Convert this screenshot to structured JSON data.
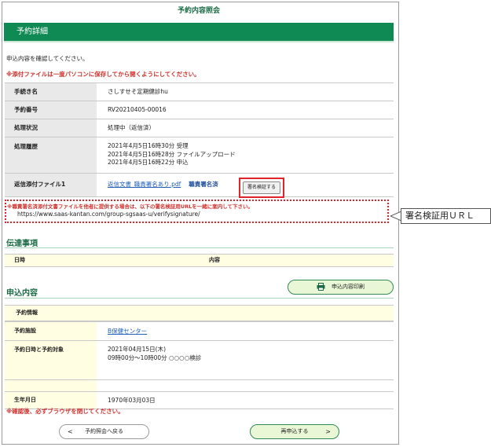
{
  "header": {
    "title": "予約内容照会"
  },
  "band": {
    "label": "予約詳細"
  },
  "messages": {
    "confirm": "申込内容を確認してください。",
    "warning": "※添付ファイルは一度パソコンに保存してから開くようにしてください。"
  },
  "details": [
    {
      "key": "手続き名",
      "value": "さしすせそ定期健診hu"
    },
    {
      "key": "予約番号",
      "value": "RV20210405-00016"
    },
    {
      "key": "処理状況",
      "value": "処理中（返信済）"
    },
    {
      "key": "処理履歴",
      "lines": [
        "2021年4月5日16時30分  受理",
        "2021年4月5日16時28分  ファイルアップロード",
        "2021年4月5日16時22分  申込"
      ]
    },
    {
      "key": "返信添付ファイル1",
      "file_link": "返信文書_職責署名あり.pdf",
      "sign_status": "職責署名済",
      "verify_label": "署名検証する"
    }
  ],
  "verify_note": "※職責署名済添付文書ファイルを他者に提供する場合は、以下の署名検証用URLを一緒に案内して下さい。",
  "verify_url": "https://www.saas-kantan.com/group-sgsaas-u/verifysignature/",
  "callout": "署名検証用ＵＲＬ",
  "notice": {
    "title": "伝達事項",
    "col_date": "日時",
    "col_content": "内容"
  },
  "application": {
    "title": "申込内容",
    "print_label": "申込内容印刷",
    "section": "予約情報",
    "facility_key": "予約施設",
    "facility_value": "B保健センター",
    "datetime_key": "予約日時と予約対象",
    "datetime_lines": [
      "2021年04月15日(木)",
      "09時00分～10時00分 ○○○○検診"
    ],
    "birth_key": "生年月日",
    "birth_value": "1970年03月03日"
  },
  "closing_warning": "※確認後、必ずブラウザを閉じてください。",
  "buttons": {
    "back": "予約照会へ戻る",
    "reapply": "再申込する",
    "back_arrow": "<",
    "reapply_arrow": ">"
  },
  "colors": {
    "brand_green": "#0f8a55",
    "warning_red": "#d0312d",
    "link_blue": "#1f5fb8"
  }
}
